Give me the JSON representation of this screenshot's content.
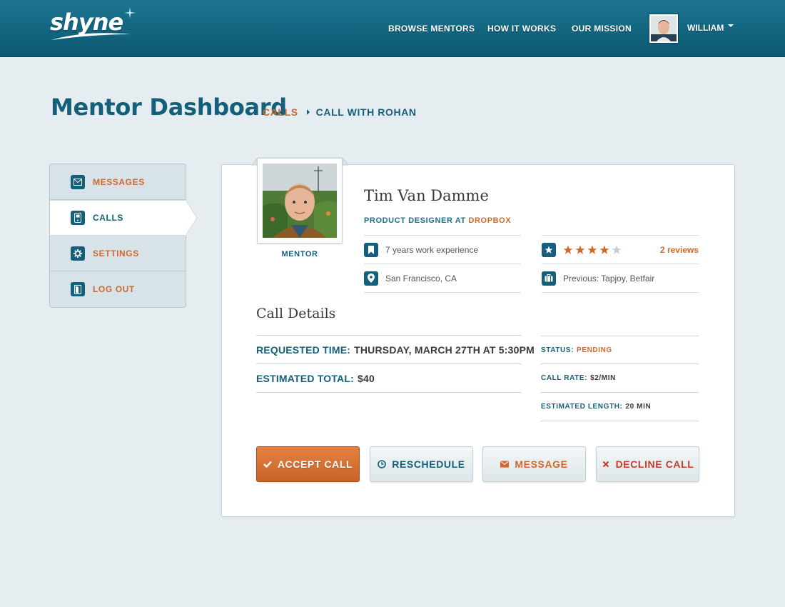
{
  "brand": {
    "logo_text": "shyne"
  },
  "nav": {
    "browse": "BROWSE MENTORS",
    "how": "HOW IT WORKS",
    "mission": "OUR MISSION",
    "user_name": "WILLIAM"
  },
  "header": {
    "title": "Mentor Dashboard",
    "breadcrumb": [
      "CALLS",
      "CALL WITH ROHAN"
    ]
  },
  "sidebar": {
    "items": [
      {
        "label": "MESSAGES",
        "icon": "envelope-icon"
      },
      {
        "label": "CALLS",
        "icon": "phone-icon",
        "active": true
      },
      {
        "label": "SETTINGS",
        "icon": "gear-icon"
      },
      {
        "label": "LOG OUT",
        "icon": "door-icon"
      }
    ]
  },
  "mentor": {
    "caption": "MENTOR",
    "name": "Tim Van Damme",
    "role_prefix": "PRODUCT DESIGNER AT",
    "company": "DROPBOX",
    "experience": "7 years work experience",
    "location": "San Francisco, CA",
    "rating": 4,
    "rating_max": 5,
    "reviews": "2 reviews",
    "previous": "Previous: Tapjoy, Betfair"
  },
  "call_details": {
    "title": "Call Details",
    "requested_key": "REQUESTED TIME:",
    "requested_val": "THURSDAY, MARCH 27TH AT 5:30PM",
    "total_key": "ESTIMATED TOTAL:",
    "total_val": "$40",
    "status_key": "STATUS:",
    "status_val": "PENDING",
    "rate_key": "CALL RATE:",
    "rate_val": "$2/MIN",
    "length_key": "ESTIMATED LENGTH:",
    "length_val": "20 MIN"
  },
  "actions": {
    "accept": "ACCEPT CALL",
    "reschedule": "RESCHEDULE",
    "message": "MESSAGE",
    "decline": "DECLINE CALL"
  },
  "colors": {
    "header": "#0d5872",
    "primary": "#145f7a",
    "accent": "#d0682a",
    "danger": "#c83a2a",
    "background": "#e6edf0"
  }
}
